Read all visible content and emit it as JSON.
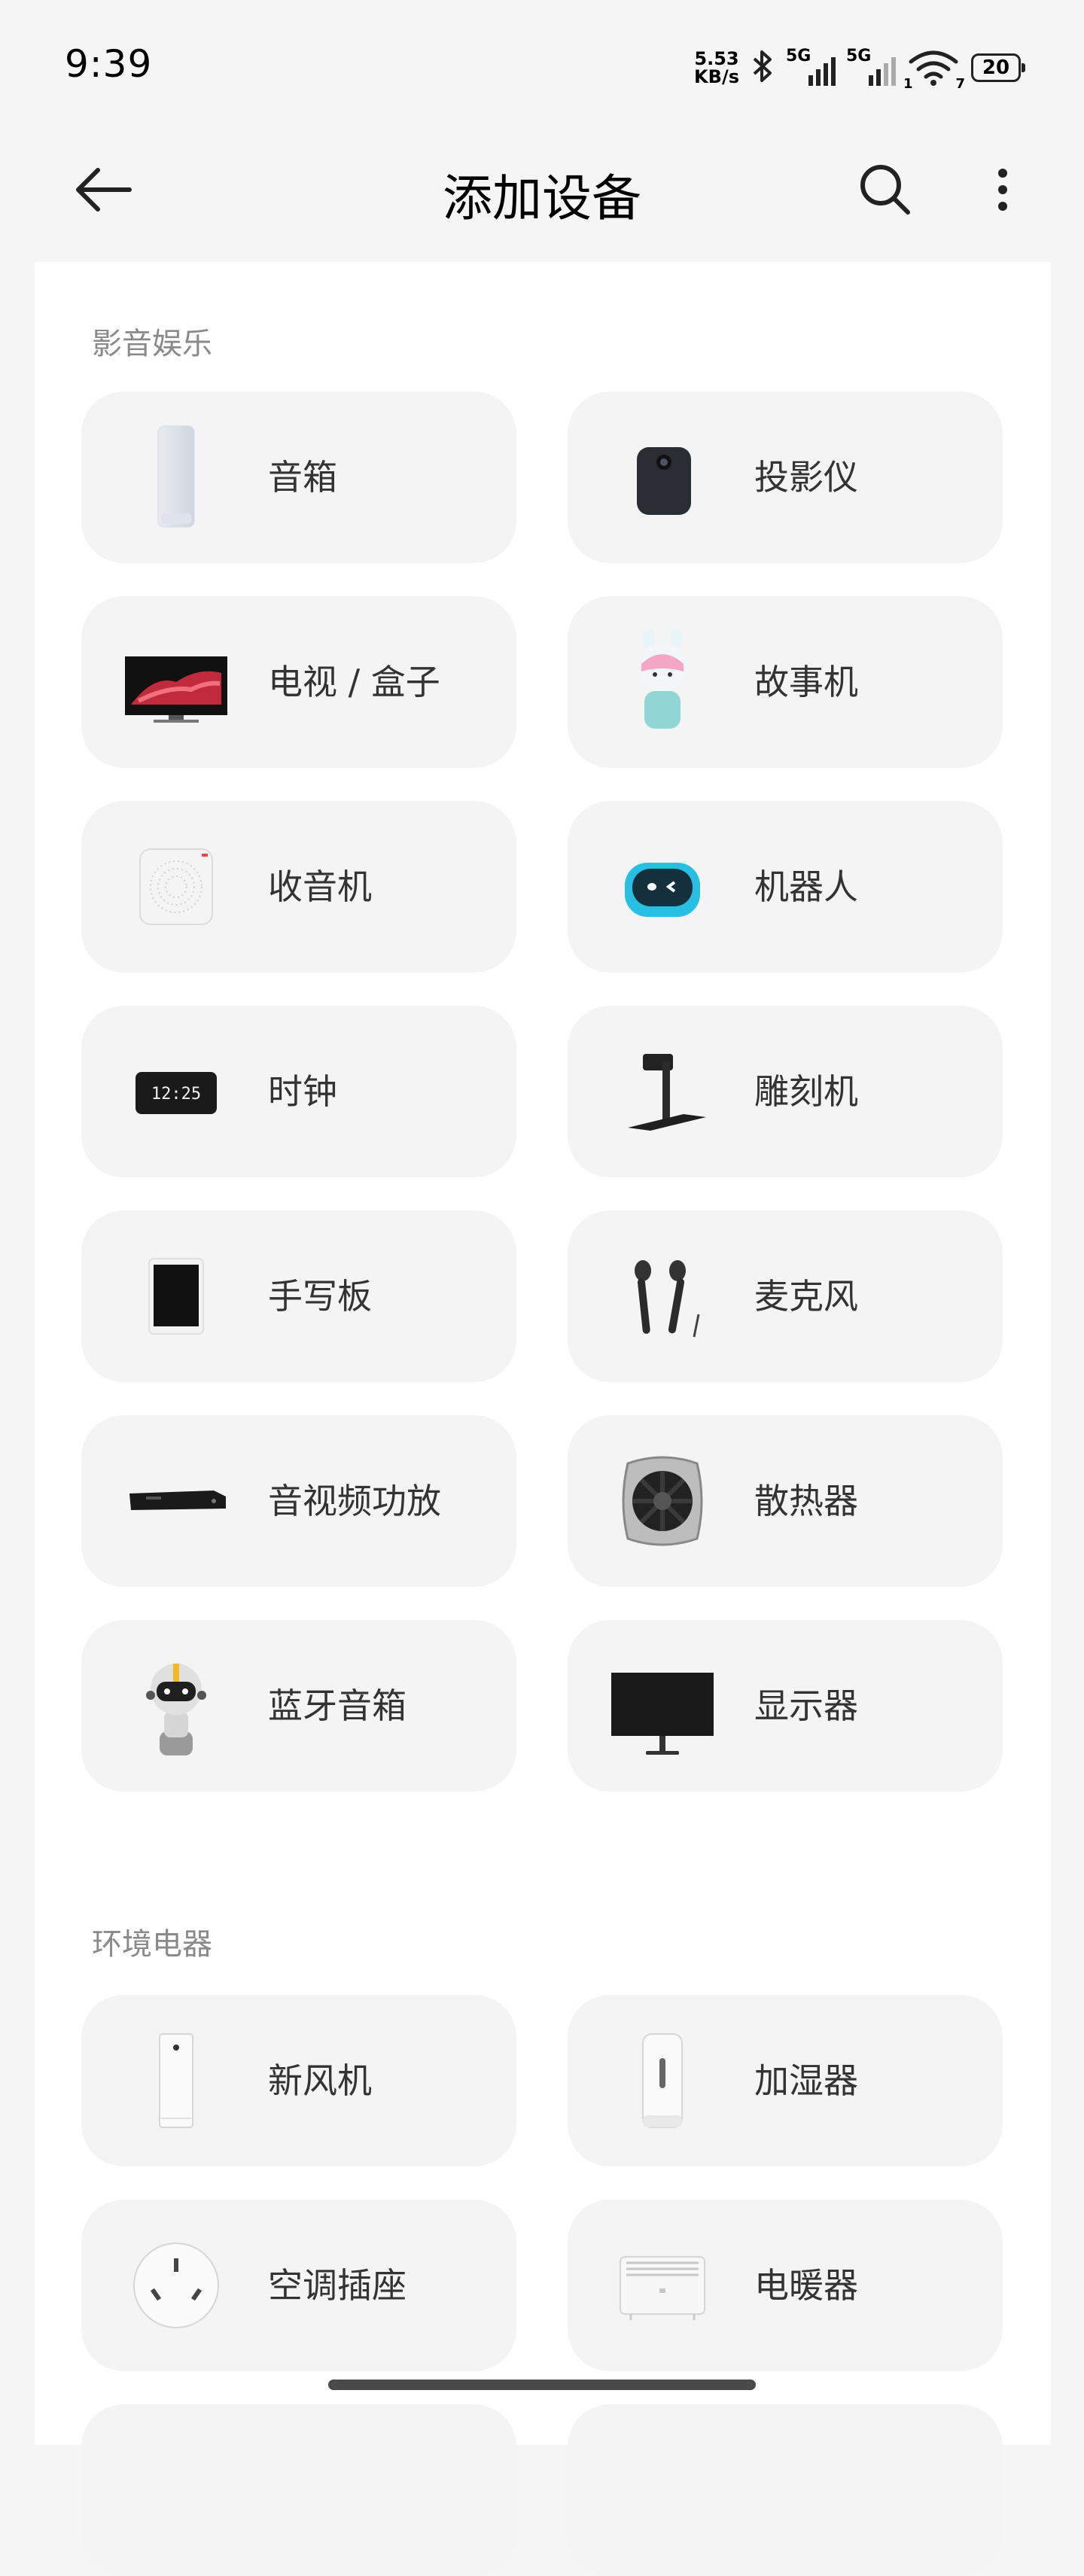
{
  "status_bar": {
    "time": "9:39",
    "net_speed_value": "5.53",
    "net_speed_unit": "KB/s",
    "sim1_label": "5G",
    "sim2_label": "5G",
    "wifi_sub": "1",
    "wifi_sub2": "7",
    "battery": "20"
  },
  "header": {
    "title": "添加设备",
    "back_icon": "arrow-left-icon",
    "search_icon": "search-icon",
    "more_icon": "more-vertical-icon"
  },
  "sections": [
    {
      "title": "影音娱乐",
      "items": [
        {
          "label": "音箱",
          "icon": "smart-speaker-icon"
        },
        {
          "label": "投影仪",
          "icon": "projector-icon"
        },
        {
          "label": "电视 / 盒子",
          "icon": "tv-icon"
        },
        {
          "label": "故事机",
          "icon": "story-machine-icon"
        },
        {
          "label": "收音机",
          "icon": "radio-icon"
        },
        {
          "label": "机器人",
          "icon": "robot-icon"
        },
        {
          "label": "时钟",
          "icon": "clock-icon"
        },
        {
          "label": "雕刻机",
          "icon": "engraver-icon"
        },
        {
          "label": "手写板",
          "icon": "tablet-icon"
        },
        {
          "label": "麦克风",
          "icon": "microphone-icon"
        },
        {
          "label": "音视频功放",
          "icon": "amplifier-icon"
        },
        {
          "label": "散热器",
          "icon": "cooler-icon"
        },
        {
          "label": "蓝牙音箱",
          "icon": "bluetooth-speaker-icon"
        },
        {
          "label": "显示器",
          "icon": "monitor-icon"
        }
      ]
    },
    {
      "title": "环境电器",
      "items": [
        {
          "label": "新风机",
          "icon": "fresh-air-icon"
        },
        {
          "label": "加湿器",
          "icon": "humidifier-icon"
        },
        {
          "label": "空调插座",
          "icon": "ac-socket-icon"
        },
        {
          "label": "电暖器",
          "icon": "heater-icon"
        }
      ]
    }
  ]
}
